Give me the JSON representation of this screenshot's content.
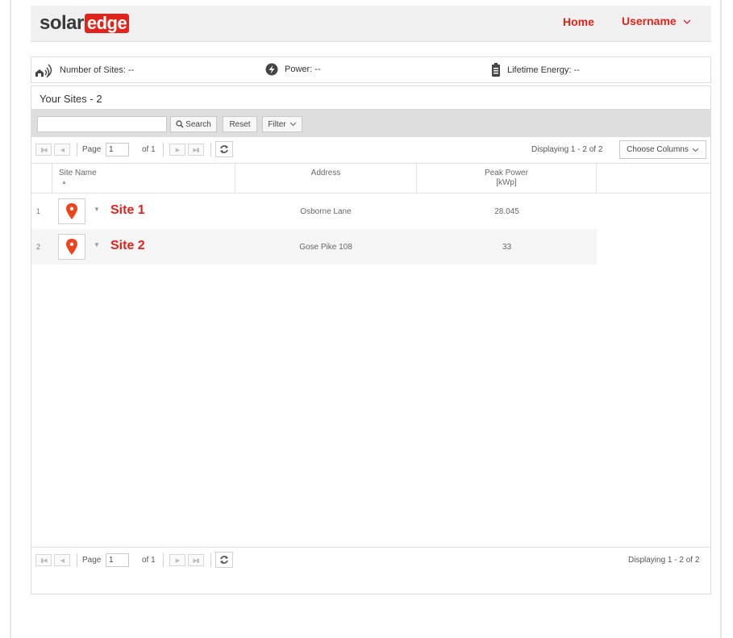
{
  "brand": {
    "solar": "solar",
    "edge": "edge",
    "accent": "#e2231a"
  },
  "nav": {
    "home": "Home",
    "username": "Username"
  },
  "stats": {
    "sites": "Number of Sites: --",
    "power": "Power: --",
    "energy": "Lifetime Energy: --"
  },
  "panel": {
    "title": "Your Sites - 2"
  },
  "search": {
    "input_value": "",
    "search_label": "Search",
    "reset_label": "Reset",
    "filter_label": "Filter"
  },
  "pager": {
    "page_label": "Page",
    "page_value": "1",
    "of_label": "of 1",
    "displaying": "Displaying 1 - 2 of 2",
    "choose_columns": "Choose Columns"
  },
  "columns": {
    "site_name": "Site Name",
    "address": "Address",
    "peak_power": "Peak Power",
    "peak_power_unit": "[kWp]"
  },
  "rows": [
    {
      "num": "1",
      "name": "Site 1",
      "address": "Osborne Lane",
      "peak": "28.045"
    },
    {
      "num": "2",
      "name": "Site 2",
      "address": "Gose Pike 108",
      "peak": "33"
    }
  ]
}
